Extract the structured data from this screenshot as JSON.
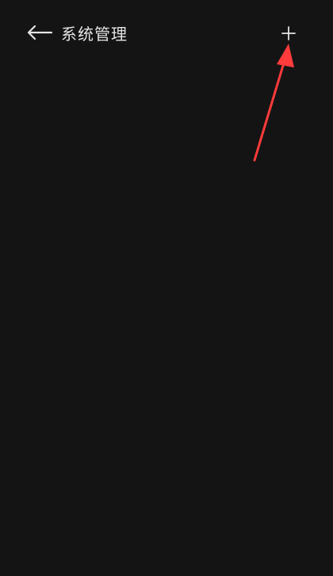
{
  "header": {
    "title": "系统管理",
    "back_icon": "arrow-left-icon",
    "add_icon": "plus-icon"
  },
  "colors": {
    "background": "#141414",
    "foreground": "#e4e4e4",
    "annotation": "#ff3b3b"
  }
}
